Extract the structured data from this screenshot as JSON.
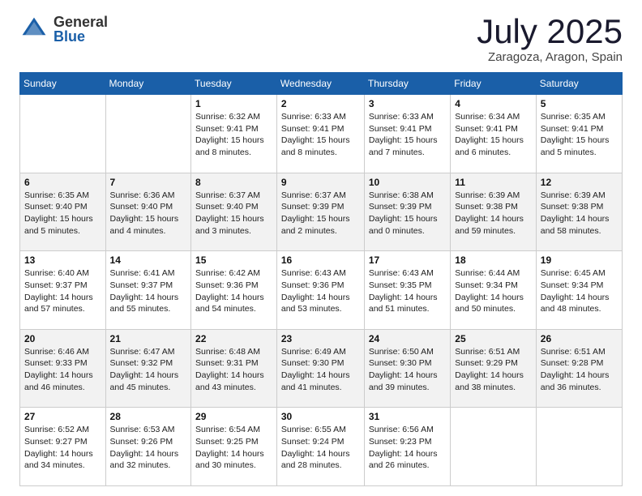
{
  "logo": {
    "general": "General",
    "blue": "Blue"
  },
  "title": "July 2025",
  "location": "Zaragoza, Aragon, Spain",
  "weekdays": [
    "Sunday",
    "Monday",
    "Tuesday",
    "Wednesday",
    "Thursday",
    "Friday",
    "Saturday"
  ],
  "weeks": [
    [
      {
        "day": "",
        "info": ""
      },
      {
        "day": "",
        "info": ""
      },
      {
        "day": "1",
        "info": "Sunrise: 6:32 AM\nSunset: 9:41 PM\nDaylight: 15 hours and 8 minutes."
      },
      {
        "day": "2",
        "info": "Sunrise: 6:33 AM\nSunset: 9:41 PM\nDaylight: 15 hours and 8 minutes."
      },
      {
        "day": "3",
        "info": "Sunrise: 6:33 AM\nSunset: 9:41 PM\nDaylight: 15 hours and 7 minutes."
      },
      {
        "day": "4",
        "info": "Sunrise: 6:34 AM\nSunset: 9:41 PM\nDaylight: 15 hours and 6 minutes."
      },
      {
        "day": "5",
        "info": "Sunrise: 6:35 AM\nSunset: 9:41 PM\nDaylight: 15 hours and 5 minutes."
      }
    ],
    [
      {
        "day": "6",
        "info": "Sunrise: 6:35 AM\nSunset: 9:40 PM\nDaylight: 15 hours and 5 minutes."
      },
      {
        "day": "7",
        "info": "Sunrise: 6:36 AM\nSunset: 9:40 PM\nDaylight: 15 hours and 4 minutes."
      },
      {
        "day": "8",
        "info": "Sunrise: 6:37 AM\nSunset: 9:40 PM\nDaylight: 15 hours and 3 minutes."
      },
      {
        "day": "9",
        "info": "Sunrise: 6:37 AM\nSunset: 9:39 PM\nDaylight: 15 hours and 2 minutes."
      },
      {
        "day": "10",
        "info": "Sunrise: 6:38 AM\nSunset: 9:39 PM\nDaylight: 15 hours and 0 minutes."
      },
      {
        "day": "11",
        "info": "Sunrise: 6:39 AM\nSunset: 9:38 PM\nDaylight: 14 hours and 59 minutes."
      },
      {
        "day": "12",
        "info": "Sunrise: 6:39 AM\nSunset: 9:38 PM\nDaylight: 14 hours and 58 minutes."
      }
    ],
    [
      {
        "day": "13",
        "info": "Sunrise: 6:40 AM\nSunset: 9:37 PM\nDaylight: 14 hours and 57 minutes."
      },
      {
        "day": "14",
        "info": "Sunrise: 6:41 AM\nSunset: 9:37 PM\nDaylight: 14 hours and 55 minutes."
      },
      {
        "day": "15",
        "info": "Sunrise: 6:42 AM\nSunset: 9:36 PM\nDaylight: 14 hours and 54 minutes."
      },
      {
        "day": "16",
        "info": "Sunrise: 6:43 AM\nSunset: 9:36 PM\nDaylight: 14 hours and 53 minutes."
      },
      {
        "day": "17",
        "info": "Sunrise: 6:43 AM\nSunset: 9:35 PM\nDaylight: 14 hours and 51 minutes."
      },
      {
        "day": "18",
        "info": "Sunrise: 6:44 AM\nSunset: 9:34 PM\nDaylight: 14 hours and 50 minutes."
      },
      {
        "day": "19",
        "info": "Sunrise: 6:45 AM\nSunset: 9:34 PM\nDaylight: 14 hours and 48 minutes."
      }
    ],
    [
      {
        "day": "20",
        "info": "Sunrise: 6:46 AM\nSunset: 9:33 PM\nDaylight: 14 hours and 46 minutes."
      },
      {
        "day": "21",
        "info": "Sunrise: 6:47 AM\nSunset: 9:32 PM\nDaylight: 14 hours and 45 minutes."
      },
      {
        "day": "22",
        "info": "Sunrise: 6:48 AM\nSunset: 9:31 PM\nDaylight: 14 hours and 43 minutes."
      },
      {
        "day": "23",
        "info": "Sunrise: 6:49 AM\nSunset: 9:30 PM\nDaylight: 14 hours and 41 minutes."
      },
      {
        "day": "24",
        "info": "Sunrise: 6:50 AM\nSunset: 9:30 PM\nDaylight: 14 hours and 39 minutes."
      },
      {
        "day": "25",
        "info": "Sunrise: 6:51 AM\nSunset: 9:29 PM\nDaylight: 14 hours and 38 minutes."
      },
      {
        "day": "26",
        "info": "Sunrise: 6:51 AM\nSunset: 9:28 PM\nDaylight: 14 hours and 36 minutes."
      }
    ],
    [
      {
        "day": "27",
        "info": "Sunrise: 6:52 AM\nSunset: 9:27 PM\nDaylight: 14 hours and 34 minutes."
      },
      {
        "day": "28",
        "info": "Sunrise: 6:53 AM\nSunset: 9:26 PM\nDaylight: 14 hours and 32 minutes."
      },
      {
        "day": "29",
        "info": "Sunrise: 6:54 AM\nSunset: 9:25 PM\nDaylight: 14 hours and 30 minutes."
      },
      {
        "day": "30",
        "info": "Sunrise: 6:55 AM\nSunset: 9:24 PM\nDaylight: 14 hours and 28 minutes."
      },
      {
        "day": "31",
        "info": "Sunrise: 6:56 AM\nSunset: 9:23 PM\nDaylight: 14 hours and 26 minutes."
      },
      {
        "day": "",
        "info": ""
      },
      {
        "day": "",
        "info": ""
      }
    ]
  ]
}
